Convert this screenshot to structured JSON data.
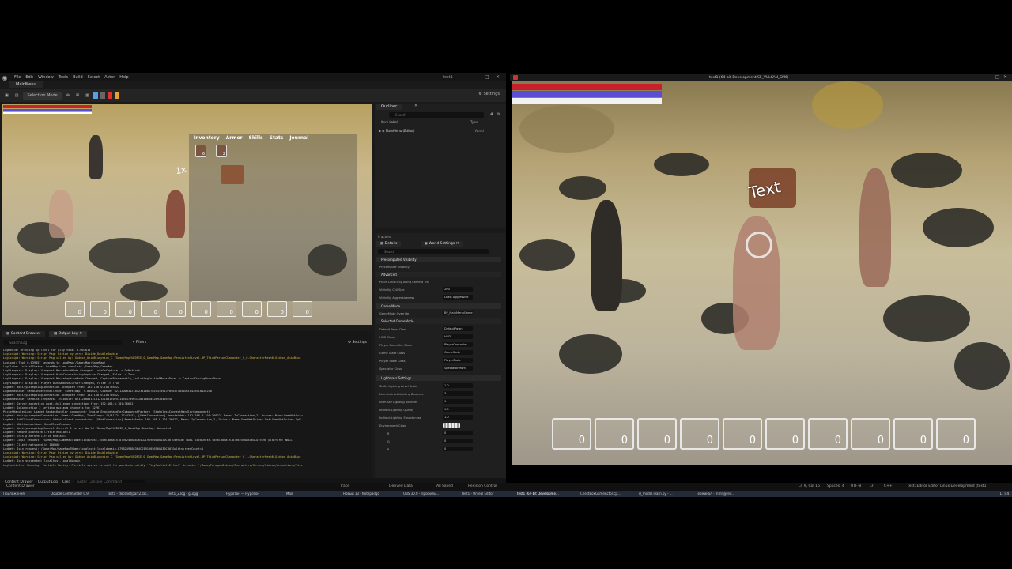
{
  "editor": {
    "menu": [
      "File",
      "Edit",
      "Window",
      "Tools",
      "Build",
      "Select",
      "Actor",
      "Help"
    ],
    "window_title": "test1",
    "tab": "MainMenu",
    "toolbar": {
      "selection_mode": "Selection Mode",
      "settings": "Settings"
    },
    "viewport": {
      "inventory_tabs": [
        "Inventory",
        "Armor",
        "Skills",
        "Stats",
        "Journal"
      ],
      "inventory_slots": [
        "6",
        "2"
      ],
      "hotbar": [
        "0",
        "0",
        "0",
        "0",
        "0",
        "0",
        "0",
        "0",
        "0",
        "0"
      ],
      "floating_text": "1x"
    },
    "outliner": {
      "tab": "Outliner",
      "search_placeholder": "Search",
      "col_label": "Item Label",
      "col_type": "Type",
      "rows": [
        {
          "label": "MainMenu (Editor)",
          "type": "World"
        }
      ]
    },
    "details": {
      "actor_count": "0 actors",
      "tab_details": "Details",
      "tab_world_settings": "World Settings",
      "search_placeholder": "Search",
      "sections": {
        "precomputed": "Precomputed Visibility",
        "advanced": "Advanced",
        "game_mode": "Game Mode",
        "selected_gamemode": "Selected GameMode",
        "lightmass": "Lightmass Settings"
      },
      "props": [
        {
          "name": "Precompute Visibility",
          "value": ""
        },
        {
          "name": "Place Cells Only Along Camera Tra",
          "value": ""
        },
        {
          "name": "Visibility Cell Size",
          "value": "200"
        },
        {
          "name": "Visibility Aggressiveness",
          "value": "Least Aggressive"
        },
        {
          "name": "GameMode Override",
          "value": "BP_MainMenuGame"
        },
        {
          "name": "Default Pawn Class",
          "value": "DefaultPawn"
        },
        {
          "name": "HUD Class",
          "value": "HUD"
        },
        {
          "name": "Player Controller Class",
          "value": "PlayerController"
        },
        {
          "name": "Game State Class",
          "value": "GameState"
        },
        {
          "name": "Player State Class",
          "value": "PlayerState"
        },
        {
          "name": "Spectator Class",
          "value": "SpectatorPawn"
        },
        {
          "name": "Static Lighting Level Scale",
          "value": "1.0"
        },
        {
          "name": "Num Indirect Lighting Bounces",
          "value": "3"
        },
        {
          "name": "Num Sky Lighting Bounces",
          "value": "1"
        },
        {
          "name": "Indirect Lighting Quality",
          "value": "1.0"
        },
        {
          "name": "Indirect Lighting Smoothness",
          "value": "1.0"
        },
        {
          "name": "Environment Color",
          "value": ""
        },
        {
          "name": "R",
          "value": "0"
        },
        {
          "name": "G",
          "value": "0"
        },
        {
          "name": "B",
          "value": "0"
        }
      ]
    },
    "bottom": {
      "tab_content_browser": "Content Browser",
      "tab_output_log": "Output Log",
      "filters": "Filters",
      "settings": "Settings",
      "search_placeholder": "Search Log",
      "log": [
        {
          "text": "LogWorld: Bringing up level for play took: 0.003813",
          "warn": false
        },
        {
          "text": "LogScript: Warning: Script Msg: Divide by zero: Divide_DoubleDouble",
          "warn": true
        },
        {
          "text": "LogScript: Warning: Script Msg called by: Gideon_AnimBlueprint_C /Game/Map/UEDPIE_0_GameMap.GameMap:PersistentLevel.BP_ThirdPersonCharacter_C_0.CharacterMesh0.Gideon_AnimBlue",
          "warn": true
        },
        {
          "text": "LogLoad: Took 0.039857 seconds to LoadMap(/Game/Map/GameMap)",
          "warn": false
        },
        {
          "text": "LogSlate: InitialStatus: LoadMap Load complete /Game/Map/GameMap",
          "warn": false
        },
        {
          "text": "LogViewport: Display: Viewport MouseLockMode Changed, LockOnCapture -> DoNotLock",
          "warn": false
        },
        {
          "text": "LogViewport: Display: Viewport HideCursorDuringCapture Changed, False -> True",
          "warn": false
        },
        {
          "text": "LogViewport: Display: Viewport MouseCaptureMode Changed, CapturePermanently_IncludingInitialMouseDown -> CaptureDuringMouseDown",
          "warn": false
        },
        {
          "text": "LogViewport: Display: Player bShowMouseCursor Changed, False -> True",
          "warn": false
        },
        {
          "text": "LogNet: NotifyAcceptingConnection accepted from: 192.168.0.101:36622",
          "warn": false
        },
        {
          "text": "LogHandshake: SendConnectChallenge. Timestamp: 9.040625, Cookie: 023120003121012331001702531491370903710510610426910426240",
          "warn": false
        },
        {
          "text": "LogNet: NotifyAcceptingConnection accepted from: 192.168.0.101:36622",
          "warn": false
        },
        {
          "text": "LogHandshake: SendChallengeAck. InCookie: 023120003121012331001702531491370903710510610426910426240",
          "warn": false
        },
        {
          "text": "LogNet: Server accepting post-challenge connection from: 192.168.0.101:36622",
          "warn": false
        },
        {
          "text": "LogNet: IpConnection_2 setting maximum channels to: 32767",
          "warn": false
        },
        {
          "text": "PacketHandlerLog: Loaded PacketHandler component: Engine.EngineHandlerComponentFactory (StatelessConnectHandlerComponent)",
          "warn": false
        },
        {
          "text": "LogNet: NotifyAcceptedConnection: Name: GameMap, TimeStamp: 10/31/24 17:43:52, [UNetConnection] RemoteAddr: 192.168.0.101:36622, Name: IpConnection_2, Driver: Name:GameNetDriv",
          "warn": false
        },
        {
          "text": "LogNet: AddClientConnection: Added client connection: [UNetConnection] RemoteAddr: 192.168.0.101:36622, Name: IpConnection_2, Driver: Name:GameNetDriver Def:GameNetDriver IpN",
          "warn": false
        },
        {
          "text": "LogNet: UNetConnection::SendCloseReason:",
          "warn": false
        },
        {
          "text": "LogNet: NotifyAcceptingChannel Control 0 server World /Game/Map/UEDPIE_0_GameMap.GameMap: Accepted",
          "warn": false
        },
        {
          "text": "LogNet: Remote platform little endian=1",
          "warn": false
        },
        {
          "text": "LogNet: This platform little endian=1",
          "warn": false
        },
        {
          "text": "LogNet: Login request: /Game/Map/GameMap?Name=localhost.localdomain-8798249888364CD1919056DCA30CB0 userId: NULL:localhost.localdomain-8798249888364CD19190 platform: NULL",
          "warn": false
        },
        {
          "text": "LogNet: Client netspeed is 100000",
          "warn": false
        },
        {
          "text": "LogNet: Join request: /Game/Map/GameMap?Name=localhost.localdomain-8798249888364CD191905650CA30CB0?SplitscreenCount=1",
          "warn": false
        },
        {
          "text": "LogScript: Warning: Script Msg: Divide by zero: Divide_DoubleDouble",
          "warn": true
        },
        {
          "text": "LogScript: Warning: Script Msg called by: Gideon_AnimBlueprint_C /Game/Map/UEDPIE_0_GameMap.GameMap:PersistentLevel.BP_ThirdPersonCharacter_C_1.CharacterMesh0.Gideon_AnimBlue",
          "warn": true
        },
        {
          "text": "LogNet: Join succeeded: localhost.localdomain",
          "warn": false
        },
        {
          "text": "LogParticles: Warning: Particle Notify: Particle system is null for particle notify 'PlayParticleEffect' in anim: '/Game/ParagonGideon/Characters/Heroes/Gideon/Animations/Fire",
          "warn": true
        }
      ]
    },
    "cmd_row": {
      "content_drawer": "Content Drawer",
      "output_log": "Output Log",
      "cmd": "Cmd",
      "cmd_placeholder": "Enter Console Command"
    }
  },
  "game": {
    "title": "test1 (64-bit Development SF_VULKAN_SM6)",
    "floating_text": "Text",
    "hotbar": [
      "0",
      "0",
      "0",
      "0",
      "0",
      "0",
      "0",
      "0",
      "0",
      "0"
    ]
  },
  "statusbar": {
    "trace": "Trace",
    "derived_data": "Derived Data",
    "all_saved": "All Saved",
    "revision_control": "Revision Control",
    "cursor_pos": "Ln 9, Col 16",
    "spaces": "Spaces: 4",
    "encoding": "UTF-8",
    "eol": "LF",
    "language": "C++",
    "config": "test1Editor Editor Linux Development (test1)"
  },
  "taskbar": {
    "items": [
      "Приложения",
      "Double Commander 0.9",
      "test1 - docsnet/part2.txt...",
      "test1_2.log - gLogg",
      "Нуротон — Нуротон",
      "Mail",
      "Новый 13 - Notepadqq",
      "OBS 30.0 - Профиль...",
      "test1 - Unreal Editor",
      "test1 (64-bit Developme...",
      "ChestBoxGameActor.cp...",
      "rl_model.learn.py - ...",
      "Терминал - mmn@fed..."
    ],
    "clock": "17:44"
  },
  "colors": {
    "health": "#c91e2c",
    "mana": "#5b4ed4",
    "stamina": "#f2f2f2",
    "log_warning": "#d8b84a"
  }
}
